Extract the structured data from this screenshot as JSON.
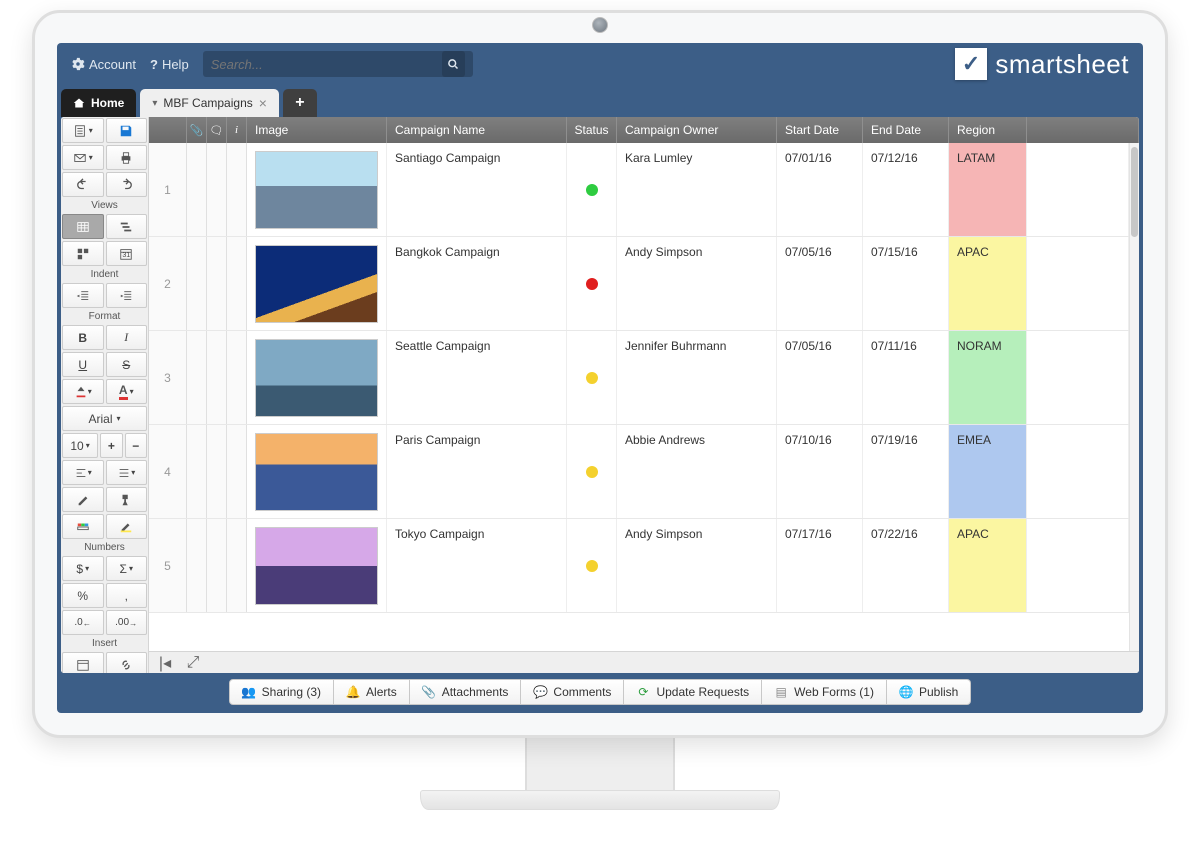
{
  "topbar": {
    "account": "Account",
    "help": "Help",
    "search_placeholder": "Search...",
    "brand": "smartsheet"
  },
  "tabs": {
    "home": "Home",
    "sheet": "MBF Campaigns"
  },
  "sidebar": {
    "views_label": "Views",
    "indent_label": "Indent",
    "format_label": "Format",
    "numbers_label": "Numbers",
    "insert_label": "Insert",
    "font_name": "Arial",
    "font_size": "10",
    "bold": "B",
    "italic": "I",
    "underline": "U",
    "strike": "S",
    "currency": "$",
    "sigma": "Σ",
    "percent": "%",
    "comma": ",",
    "decimal_dec": ".0₋",
    "decimal_inc": ".00₊"
  },
  "columns": {
    "image": "Image",
    "name": "Campaign Name",
    "status": "Status",
    "owner": "Campaign Owner",
    "start": "Start Date",
    "end": "End Date",
    "region": "Region"
  },
  "rows": [
    {
      "num": "1",
      "name": "Santiago Campaign",
      "status_color": "#2ecc40",
      "owner": "Kara Lumley",
      "start": "07/01/16",
      "end": "07/12/16",
      "region": "LATAM",
      "region_bg": "#f6b5b5",
      "img": "santiago"
    },
    {
      "num": "2",
      "name": "Bangkok Campaign",
      "status_color": "#e01e1e",
      "owner": "Andy Simpson",
      "start": "07/05/16",
      "end": "07/15/16",
      "region": "APAC",
      "region_bg": "#fbf6a1",
      "img": "bangkok"
    },
    {
      "num": "3",
      "name": "Seattle Campaign",
      "status_color": "#f4d12e",
      "owner": "Jennifer Buhrmann",
      "start": "07/05/16",
      "end": "07/11/16",
      "region": "NORAM",
      "region_bg": "#b6efbb",
      "img": "seattle"
    },
    {
      "num": "4",
      "name": "Paris Campaign",
      "status_color": "#f4d12e",
      "owner": "Abbie Andrews",
      "start": "07/10/16",
      "end": "07/19/16",
      "region": "EMEA",
      "region_bg": "#aec8ef",
      "img": "paris"
    },
    {
      "num": "5",
      "name": "Tokyo Campaign",
      "status_color": "#f4d12e",
      "owner": "Andy Simpson",
      "start": "07/17/16",
      "end": "07/22/16",
      "region": "APAC",
      "region_bg": "#fbf6a1",
      "img": "tokyo"
    }
  ],
  "bottombar": {
    "sharing": "Sharing  (3)",
    "alerts": "Alerts",
    "attachments": "Attachments",
    "comments": "Comments",
    "updates": "Update Requests",
    "webforms": "Web Forms  (1)",
    "publish": "Publish"
  }
}
